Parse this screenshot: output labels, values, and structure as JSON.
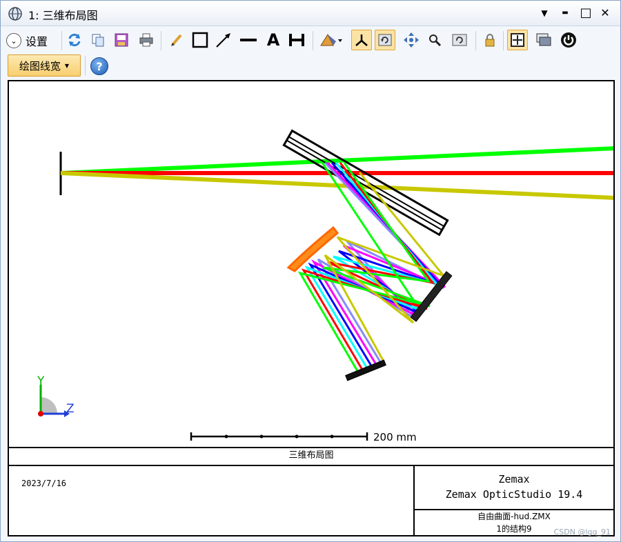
{
  "window": {
    "title": "1: 三维布局图",
    "minimize_symbol": "▬",
    "maximize_symbol": "□",
    "close_symbol": "✕",
    "dropdown_symbol": "▼"
  },
  "toolbar": {
    "settings_label": "设置",
    "line_width_label": "绘图线宽",
    "help_label": "?",
    "text_tool_label": "A"
  },
  "plot": {
    "scale_label": "200 mm",
    "axis_y": "Y",
    "axis_z": "Z",
    "caption": "三维布局图",
    "date": "2023/7/16",
    "brand": "Zemax",
    "product": "Zemax OpticStudio 19.4",
    "file": "自由曲面-hud.ZMX",
    "config": "1的结构9"
  },
  "ray_colors": [
    "#00ff00",
    "#ff0000",
    "#c8c800",
    "#0000ff",
    "#ff00ff",
    "#00ffff",
    "#8888ff",
    "#ff8800"
  ],
  "watermark": "CSDN @lgq_91"
}
